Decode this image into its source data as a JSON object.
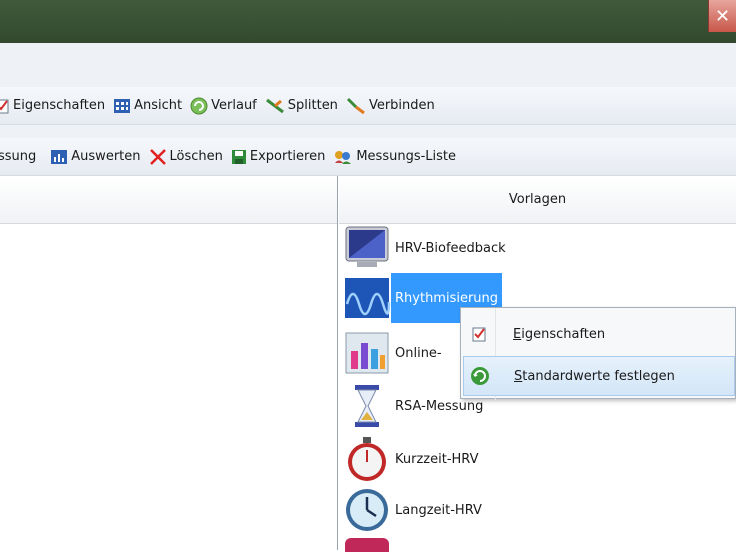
{
  "window": {
    "close_label": "✕"
  },
  "toolbar1": {
    "items": [
      {
        "label": "Eigenschaften",
        "icon": "properties-icon"
      },
      {
        "label": "Ansicht",
        "icon": "view-grid-icon"
      },
      {
        "label": "Verlauf",
        "icon": "history-icon"
      },
      {
        "label": "Splitten",
        "icon": "split-icon"
      },
      {
        "label": "Verbinden",
        "icon": "connect-icon"
      }
    ]
  },
  "toolbar2": {
    "items": [
      {
        "label": "ssung",
        "icon": ""
      },
      {
        "label": "Auswerten",
        "icon": "evaluate-icon"
      },
      {
        "label": "Löschen",
        "icon": "delete-icon"
      },
      {
        "label": "Exportieren",
        "icon": "export-icon"
      },
      {
        "label": "Messungs-Liste",
        "icon": "measurement-list-icon"
      }
    ]
  },
  "templates": {
    "header": "Vorlagen",
    "items": [
      {
        "label": "HRV-Biofeedback",
        "icon": "monitor-icon"
      },
      {
        "label": "Rhythmisierung",
        "icon": "wave-icon",
        "selected": true
      },
      {
        "label": "Online-",
        "icon": "bar-chart-icon"
      },
      {
        "label": "RSA-Messung",
        "icon": "hourglass-icon"
      },
      {
        "label": "Kurzzeit-HRV",
        "icon": "stopwatch-icon"
      },
      {
        "label": "Langzeit-HRV",
        "icon": "clock-icon"
      }
    ]
  },
  "context_menu": {
    "items": [
      {
        "first": "E",
        "rest": "igenschaften",
        "icon": "properties-icon"
      },
      {
        "first": "S",
        "rest": "tandardwerte festlegen",
        "icon": "refresh-icon",
        "highlighted": true
      }
    ]
  },
  "colors": {
    "selection": "#3399ff",
    "titlebar": "#3a5236",
    "close": "#d9685c"
  }
}
